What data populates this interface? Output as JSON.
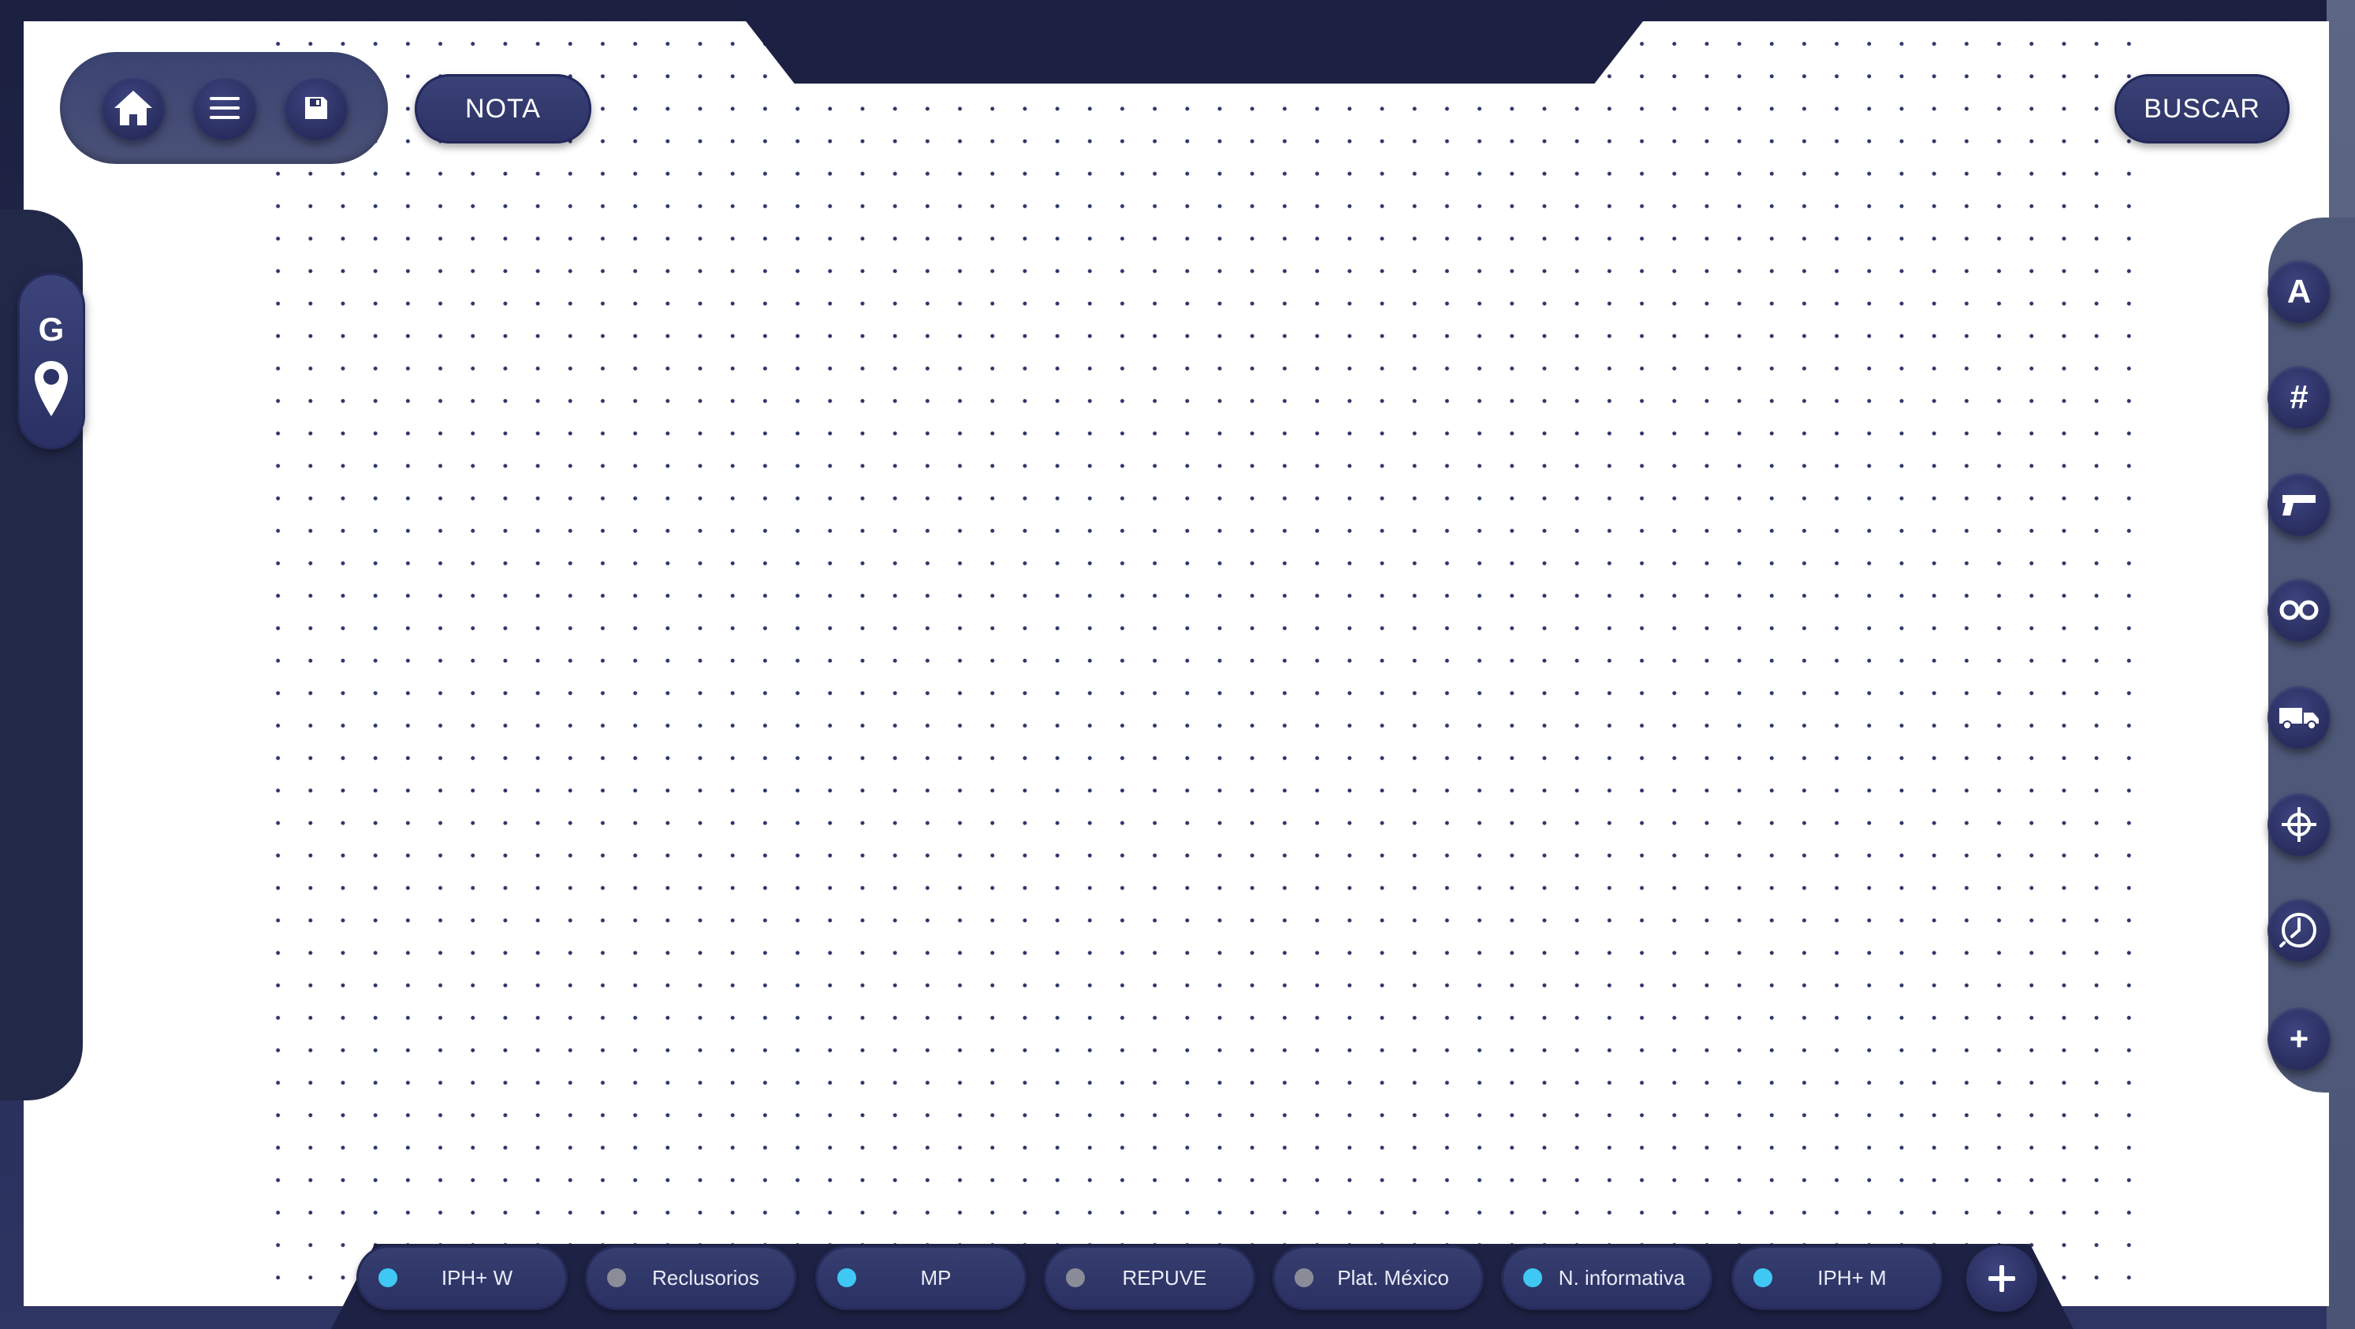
{
  "colors": {
    "frame": "#1f2446",
    "panel": "#ffffff",
    "button": "#2c3264",
    "active_dot": "#3fc8f4",
    "inactive_dot": "#8a8d98"
  },
  "toolbar": {
    "home_icon": "home-icon",
    "menu_icon": "menu-icon",
    "save_icon": "save-icon",
    "note_label": "NOTA",
    "search_label": "BUSCAR"
  },
  "geo_tab": {
    "letter": "G",
    "icon": "location-pin-icon"
  },
  "side_tools": [
    {
      "name": "text-tool",
      "glyph": "A"
    },
    {
      "name": "number-tool",
      "glyph": "#"
    },
    {
      "name": "weapon-tool",
      "icon": "pistol-icon"
    },
    {
      "name": "handcuffs-tool",
      "icon": "handcuffs-icon"
    },
    {
      "name": "vehicle-tool",
      "icon": "truck-icon"
    },
    {
      "name": "target-tool",
      "icon": "crosshair-icon"
    },
    {
      "name": "time-tool",
      "icon": "clock-icon"
    },
    {
      "name": "add-tool",
      "glyph": "+"
    }
  ],
  "bottom_tabs": [
    {
      "label": "IPH+ W",
      "status": "active"
    },
    {
      "label": "Reclusorios",
      "status": "inactive"
    },
    {
      "label": "MP",
      "status": "active"
    },
    {
      "label": "REPUVE",
      "status": "inactive"
    },
    {
      "label": "Plat. México",
      "status": "inactive"
    },
    {
      "label": "N. informativa",
      "status": "active"
    },
    {
      "label": "IPH+ M",
      "status": "active"
    }
  ],
  "add_tab": {
    "glyph": "+"
  }
}
